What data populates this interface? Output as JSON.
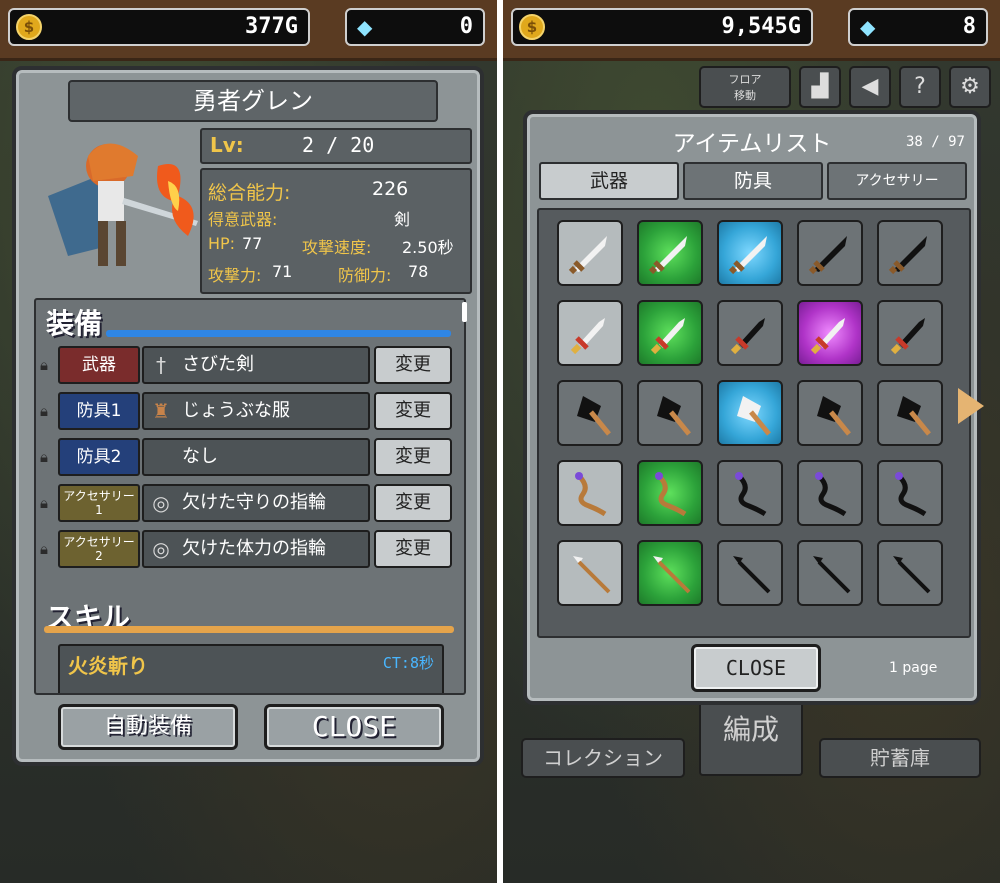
{
  "left": {
    "currency": {
      "gold": "377G",
      "gems": "0"
    },
    "hero": {
      "name": "勇者グレン",
      "level_label": "Lv:",
      "level_value": "2 / 20",
      "stats": {
        "total_label": "総合能力:",
        "total_value": "226",
        "fav_weapon_label": "得意武器:",
        "fav_weapon_value": "剣",
        "hp_label": "HP:",
        "hp_value": "77",
        "atk_speed_label": "攻撃速度:",
        "atk_speed_value": "2.50秒",
        "atk_label": "攻撃力:",
        "atk_value": "71",
        "def_label": "防御力:",
        "def_value": "78"
      }
    },
    "equipment_title": "装備",
    "equipment": [
      {
        "slot": "武器",
        "item": "さびた剣",
        "icon": "sword-icon",
        "button": "変更",
        "type": "weapon"
      },
      {
        "slot": "防具1",
        "item": "じょうぶな服",
        "icon": "armor-icon",
        "button": "変更",
        "type": "armor"
      },
      {
        "slot": "防具2",
        "item": "なし",
        "icon": "",
        "button": "変更",
        "type": "armor"
      },
      {
        "slot": "アクセサリー1",
        "item": "欠けた守りの指輪",
        "icon": "ring-icon",
        "button": "変更",
        "type": "acc"
      },
      {
        "slot": "アクセサリー2",
        "item": "欠けた体力の指輪",
        "icon": "ring-icon",
        "button": "変更",
        "type": "acc"
      }
    ],
    "skill_title": "スキル",
    "skill": {
      "name": "火炎斬り",
      "ct": "CT:8秒"
    },
    "buttons": {
      "auto_equip": "自動装備",
      "close": "CLOSE"
    }
  },
  "right": {
    "currency": {
      "gold": "9,545G",
      "gems": "8"
    },
    "top_buttons": {
      "floor": "フロア\n移動"
    },
    "item_list": {
      "title": "アイテムリスト",
      "count": "38 / 97",
      "tabs": [
        "武器",
        "防具",
        "アクセサリー"
      ],
      "active_tab": 0,
      "page": "1 page",
      "close": "CLOSE",
      "grid": [
        [
          "gray",
          "green",
          "blue",
          "locked",
          "locked"
        ],
        [
          "gray",
          "green",
          "locked",
          "purple",
          "locked"
        ],
        [
          "locked",
          "locked",
          "blue",
          "locked",
          "locked"
        ],
        [
          "gray",
          "green",
          "locked",
          "locked",
          "locked"
        ],
        [
          "gray",
          "green",
          "locked",
          "locked",
          "locked"
        ]
      ],
      "row_items": [
        "sword",
        "dagger",
        "axe",
        "staff",
        "spear"
      ]
    },
    "bottom_menu": {
      "collection": "コレクション",
      "formation": "編成",
      "storage": "貯蓄庫"
    }
  }
}
